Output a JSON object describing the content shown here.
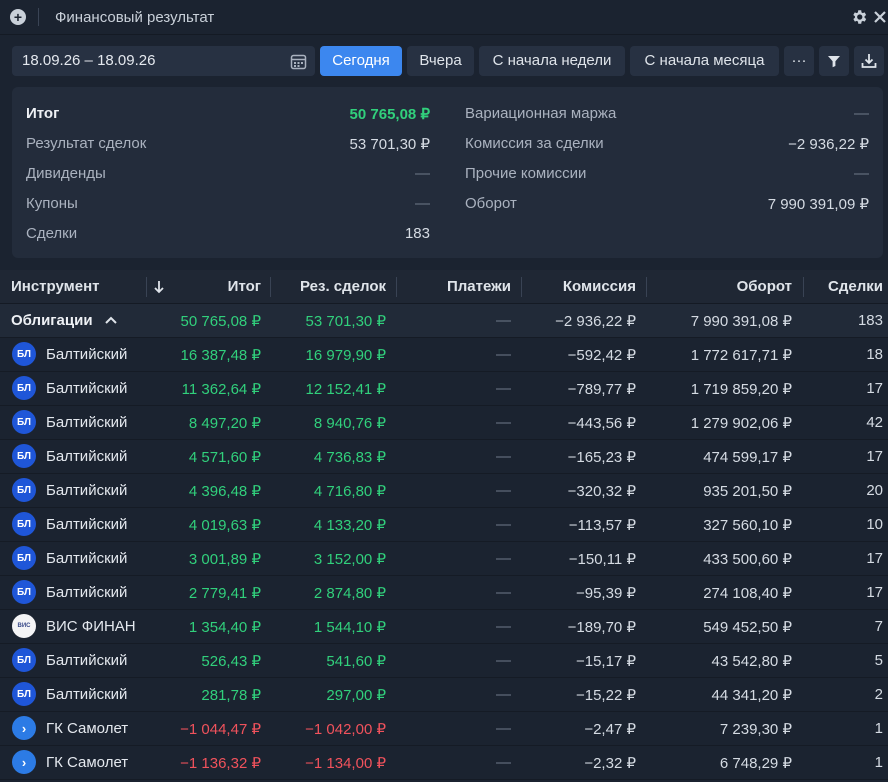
{
  "window": {
    "title": "Финансовый результат"
  },
  "toolbar": {
    "date_range": "18.09.26 – 18.09.26",
    "today": "Сегодня",
    "yesterday": "Вчера",
    "week": "С начала недели",
    "month": "С начала месяца",
    "more": "···"
  },
  "summary": {
    "left": [
      {
        "label": "Итог",
        "value": "50 765,08 ₽"
      },
      {
        "label": "Результат сделок",
        "value": "53 701,30 ₽"
      },
      {
        "label": "Дивиденды",
        "value": "—"
      },
      {
        "label": "Купоны",
        "value": "—"
      },
      {
        "label": "Сделки",
        "value": "183"
      }
    ],
    "right": [
      {
        "label": "Вариационная маржа",
        "value": "—"
      },
      {
        "label": "Комиссия за сделки",
        "value": "−2 936,22 ₽"
      },
      {
        "label": "Прочие комиссии",
        "value": "—"
      },
      {
        "label": "Оборот",
        "value": "7 990 391,09 ₽"
      }
    ]
  },
  "table": {
    "headers": {
      "instrument": "Инструмент",
      "total": "Итог",
      "deals_result": "Рез. сделок",
      "payments": "Платежи",
      "commission": "Комиссия",
      "turnover": "Оборот",
      "deals": "Сделки"
    },
    "group": {
      "name": "Облигации",
      "total": "50 765,08 ₽",
      "deals_result": "53 701,30 ₽",
      "payments": "—",
      "commission": "−2 936,22 ₽",
      "turnover": "7 990 391,08 ₽",
      "deals": "183"
    },
    "rows": [
      {
        "logo": "БЛ",
        "name": "Балтийский",
        "total": "16 387,48 ₽",
        "deals_result": "16 979,90 ₽",
        "payments": "—",
        "commission": "−592,42 ₽",
        "turnover": "1 772 617,71 ₽",
        "deals": "18"
      },
      {
        "logo": "БЛ",
        "name": "Балтийский",
        "total": "11 362,64 ₽",
        "deals_result": "12 152,41 ₽",
        "payments": "—",
        "commission": "−789,77 ₽",
        "turnover": "1 719 859,20 ₽",
        "deals": "17"
      },
      {
        "logo": "БЛ",
        "name": "Балтийский",
        "total": "8 497,20 ₽",
        "deals_result": "8 940,76 ₽",
        "payments": "—",
        "commission": "−443,56 ₽",
        "turnover": "1 279 902,06 ₽",
        "deals": "42"
      },
      {
        "logo": "БЛ",
        "name": "Балтийский",
        "total": "4 571,60 ₽",
        "deals_result": "4 736,83 ₽",
        "payments": "—",
        "commission": "−165,23 ₽",
        "turnover": "474 599,17 ₽",
        "deals": "17"
      },
      {
        "logo": "БЛ",
        "name": "Балтийский",
        "total": "4 396,48 ₽",
        "deals_result": "4 716,80 ₽",
        "payments": "—",
        "commission": "−320,32 ₽",
        "turnover": "935 201,50 ₽",
        "deals": "20"
      },
      {
        "logo": "БЛ",
        "name": "Балтийский",
        "total": "4 019,63 ₽",
        "deals_result": "4 133,20 ₽",
        "payments": "—",
        "commission": "−113,57 ₽",
        "turnover": "327 560,10 ₽",
        "deals": "10"
      },
      {
        "logo": "БЛ",
        "name": "Балтийский",
        "total": "3 001,89 ₽",
        "deals_result": "3 152,00 ₽",
        "payments": "—",
        "commission": "−150,11 ₽",
        "turnover": "433 500,60 ₽",
        "deals": "17"
      },
      {
        "logo": "БЛ",
        "name": "Балтийский",
        "total": "2 779,41 ₽",
        "deals_result": "2 874,80 ₽",
        "payments": "—",
        "commission": "−95,39 ₽",
        "turnover": "274 108,40 ₽",
        "deals": "17"
      },
      {
        "logo": "ВИС",
        "name": "ВИС ФИНАНС",
        "total": "1 354,40 ₽",
        "deals_result": "1 544,10 ₽",
        "payments": "—",
        "commission": "−189,70 ₽",
        "turnover": "549 452,50 ₽",
        "deals": "7"
      },
      {
        "logo": "БЛ",
        "name": "Балтийский",
        "total": "526,43 ₽",
        "deals_result": "541,60 ₽",
        "payments": "—",
        "commission": "−15,17 ₽",
        "turnover": "43 542,80 ₽",
        "deals": "5"
      },
      {
        "logo": "БЛ",
        "name": "Балтийский",
        "total": "281,78 ₽",
        "deals_result": "297,00 ₽",
        "payments": "—",
        "commission": "−15,22 ₽",
        "turnover": "44 341,20 ₽",
        "deals": "2"
      },
      {
        "logo": "›",
        "name": "ГК Самолет",
        "total": "−1 044,47 ₽",
        "deals_result": "−1 042,00 ₽",
        "payments": "—",
        "commission": "−2,47 ₽",
        "turnover": "7 239,30 ₽",
        "deals": "1"
      },
      {
        "logo": "›",
        "name": "ГК Самолет",
        "total": "−1 136,32 ₽",
        "deals_result": "−1 134,00 ₽",
        "payments": "—",
        "commission": "−2,32 ₽",
        "turnover": "6 748,29 ₽",
        "deals": "1"
      }
    ]
  },
  "colors": {
    "accent": "#3c87ef",
    "positive": "#31d07c",
    "negative": "#f0525c"
  }
}
